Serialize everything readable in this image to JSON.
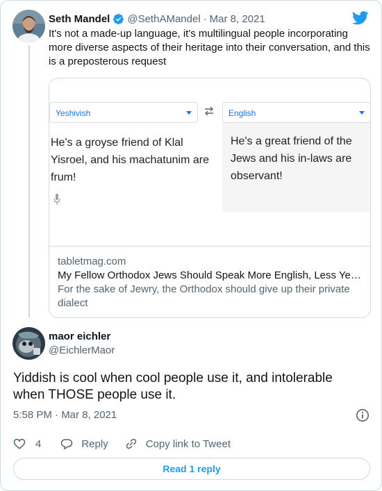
{
  "quoted_tweet": {
    "author_name": "Seth Mandel",
    "handle": "@SethAMandel",
    "separator": "·",
    "date": "Mar 8, 2021",
    "text": "It's not a made-up language, it's multilingual people incorporating more diverse aspects of their heritage into their conversation, and this is a preposterous request",
    "link_card": {
      "source_lang": "Yeshivish",
      "target_lang": "English",
      "source_text": "He's a groyse friend of Klal Yisroel, and his machatunim are frum!",
      "target_text": "He's a great friend of the Jews and his in-laws are observant!",
      "domain": "tabletmag.com",
      "title": "My Fellow Orthodox Jews Should Speak More English, Less Yeshivish",
      "description": "For the sake of Jewry, the Orthodox should give up their private dialect"
    }
  },
  "reply": {
    "author_name": "maor eichler",
    "handle": "@EichlerMaor",
    "text": "Yiddish is cool when cool people use it, and intolerable when THOSE people use it.",
    "timestamp": "5:58 PM · Mar 8, 2021"
  },
  "actions": {
    "like_count": "4",
    "reply_label": "Reply",
    "copy_link_label": "Copy link to Tweet"
  },
  "read_reply_label": "Read 1 reply",
  "colors": {
    "accent": "#1d9bf0",
    "text": "#0f1419",
    "muted": "#536471",
    "border": "#cfd9de",
    "translate_blue": "#1a73e8"
  }
}
